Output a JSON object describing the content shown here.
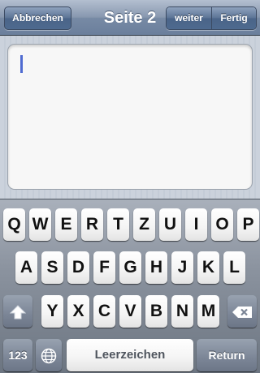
{
  "navbar": {
    "title": "Seite 2",
    "cancel_label": "Abbrechen",
    "next_label": "weiter",
    "done_label": "Fertig"
  },
  "editor": {
    "value": ""
  },
  "keyboard": {
    "row1": [
      "Q",
      "W",
      "E",
      "R",
      "T",
      "Z",
      "U",
      "I",
      "O",
      "P"
    ],
    "row2": [
      "A",
      "S",
      "D",
      "F",
      "G",
      "H",
      "J",
      "K",
      "L"
    ],
    "row3": [
      "Y",
      "X",
      "C",
      "V",
      "B",
      "N",
      "M"
    ],
    "numbers_label": "123",
    "space_label": "Leerzeichen",
    "return_label": "Return",
    "icons": {
      "shift": "shift-arrow-icon",
      "delete": "backspace-icon",
      "globe": "globe-icon"
    }
  },
  "colors": {
    "navbar": "#7a8ca6",
    "caret": "#4f6bd1",
    "keyboard_bg": "#8b939f"
  }
}
